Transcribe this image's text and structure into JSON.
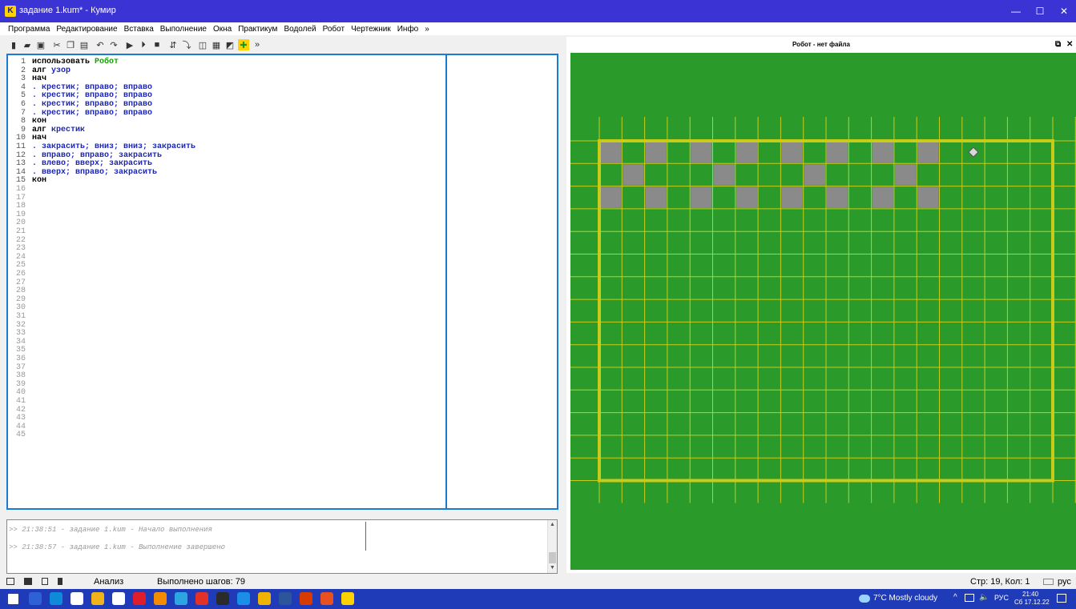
{
  "window": {
    "title": "задание 1.kum* - Кумир",
    "logo_letter": "K",
    "min": "—",
    "max": "☐",
    "close": "✕"
  },
  "menu": [
    "Программа",
    "Редактирование",
    "Вставка",
    "Выполнение",
    "Окна",
    "Практикум",
    "Водолей",
    "Робот",
    "Чертежник",
    "Инфо",
    "»"
  ],
  "toolbar": {
    "icons": [
      "new-icon",
      "open-icon",
      "save-icon",
      "cut-icon",
      "copy-icon",
      "paste-icon",
      "undo-icon",
      "redo-icon",
      "run-icon",
      "run-steps-icon",
      "stop-icon",
      "step-over-icon",
      "step-into-icon",
      "robot-window-icon",
      "vodoley-window-icon",
      "draftsman-window-icon",
      "field-icon"
    ],
    "overflow": "»"
  },
  "editor": {
    "lines": [
      {
        "n": "1",
        "segs": [
          {
            "t": "использовать ",
            "c": "kw"
          },
          {
            "t": "Робот",
            "c": "gr"
          }
        ]
      },
      {
        "n": "2",
        "segs": [
          {
            "t": "алг ",
            "c": "kw"
          },
          {
            "t": "узор",
            "c": "nm"
          }
        ]
      },
      {
        "n": "3",
        "segs": [
          {
            "t": "нач",
            "c": "kw"
          }
        ]
      },
      {
        "n": "4",
        "segs": [
          {
            "t": ". крестик; вправо; вправо",
            "c": "nm"
          }
        ]
      },
      {
        "n": "5",
        "segs": [
          {
            "t": ". крестик; вправо; вправо",
            "c": "nm"
          }
        ]
      },
      {
        "n": "6",
        "segs": [
          {
            "t": ". крестик; вправо; вправо",
            "c": "nm"
          }
        ]
      },
      {
        "n": "7",
        "segs": [
          {
            "t": ". крестик; вправо; вправо",
            "c": "nm"
          }
        ]
      },
      {
        "n": "8",
        "segs": [
          {
            "t": "кон",
            "c": "kw"
          }
        ]
      },
      {
        "n": "9",
        "segs": [
          {
            "t": "алг ",
            "c": "kw"
          },
          {
            "t": "крестик",
            "c": "nm"
          }
        ]
      },
      {
        "n": "10",
        "segs": [
          {
            "t": "нач",
            "c": "kw"
          }
        ]
      },
      {
        "n": "11",
        "segs": [
          {
            "t": ". закрасить; вниз; вниз; закрасить",
            "c": "nm"
          }
        ]
      },
      {
        "n": "12",
        "segs": [
          {
            "t": ". вправо; вправо; закрасить",
            "c": "nm"
          }
        ]
      },
      {
        "n": "13",
        "segs": [
          {
            "t": ". влево; вверх; закрасить",
            "c": "nm"
          }
        ]
      },
      {
        "n": "14",
        "segs": [
          {
            "t": ". вверх; вправо; закрасить",
            "c": "nm"
          }
        ]
      },
      {
        "n": "15",
        "segs": [
          {
            "t": "кон",
            "c": "kw"
          }
        ]
      }
    ],
    "total_lines": 45
  },
  "console": {
    "messages": [
      ">> 21:38:51 - задание 1.kum - Начало выполнения",
      ">> 21:38:57 - задание 1.kum - Выполнение завершено"
    ]
  },
  "robot": {
    "title": "Робот - нет файла",
    "dock_btn": "⧉",
    "close_btn": "✕",
    "cols": 20,
    "rows": 15,
    "painted": [
      [
        0,
        0
      ],
      [
        2,
        0
      ],
      [
        4,
        0
      ],
      [
        6,
        0
      ],
      [
        8,
        0
      ],
      [
        10,
        0
      ],
      [
        12,
        0
      ],
      [
        14,
        0
      ],
      [
        1,
        1
      ],
      [
        5,
        1
      ],
      [
        9,
        1
      ],
      [
        13,
        1
      ],
      [
        0,
        2
      ],
      [
        2,
        2
      ],
      [
        4,
        2
      ],
      [
        6,
        2
      ],
      [
        8,
        2
      ],
      [
        10,
        2
      ],
      [
        12,
        2
      ],
      [
        14,
        2
      ]
    ],
    "robot_pos": [
      16,
      0
    ],
    "colors": {
      "field": "#2a9a2b",
      "wall": "#c9cb1a",
      "grid": "#c9cb1a",
      "painted": "#8a8a8a",
      "robot": "#d8d8d8"
    }
  },
  "status": {
    "mode": "Анализ",
    "steps": "Выполнено шагов: 79",
    "position": "Стр: 19, Кол: 1",
    "lang": "рус"
  },
  "taskbar": {
    "weather": "7°C  Mostly cloudy",
    "lang": "РУС",
    "time": "21:40",
    "date": "Сб 17.12.22",
    "apps": [
      "start-icon",
      "calculator-icon",
      "edge-icon",
      "store-icon",
      "explorer-icon",
      "mail-icon",
      "opera-icon",
      "odnoklassniki-icon",
      "telegram-icon",
      "acrobat-icon",
      "app-icon",
      "skype-icon",
      "chrome-icon",
      "word-icon",
      "app2-icon",
      "powerpoint-icon",
      "kumir-icon"
    ],
    "app_colors": [
      "#ffffff",
      "#2f61d6",
      "#0f8ad8",
      "#ffffff",
      "#f2b21a",
      "#ffffff",
      "#e01d2a",
      "#f58b00",
      "#2ca5e0",
      "#e33127",
      "#2b2b2b",
      "#1b8ee7",
      "#f0b400",
      "#2b579a",
      "#d83b01",
      "#e6511f",
      "#ffd200"
    ]
  }
}
